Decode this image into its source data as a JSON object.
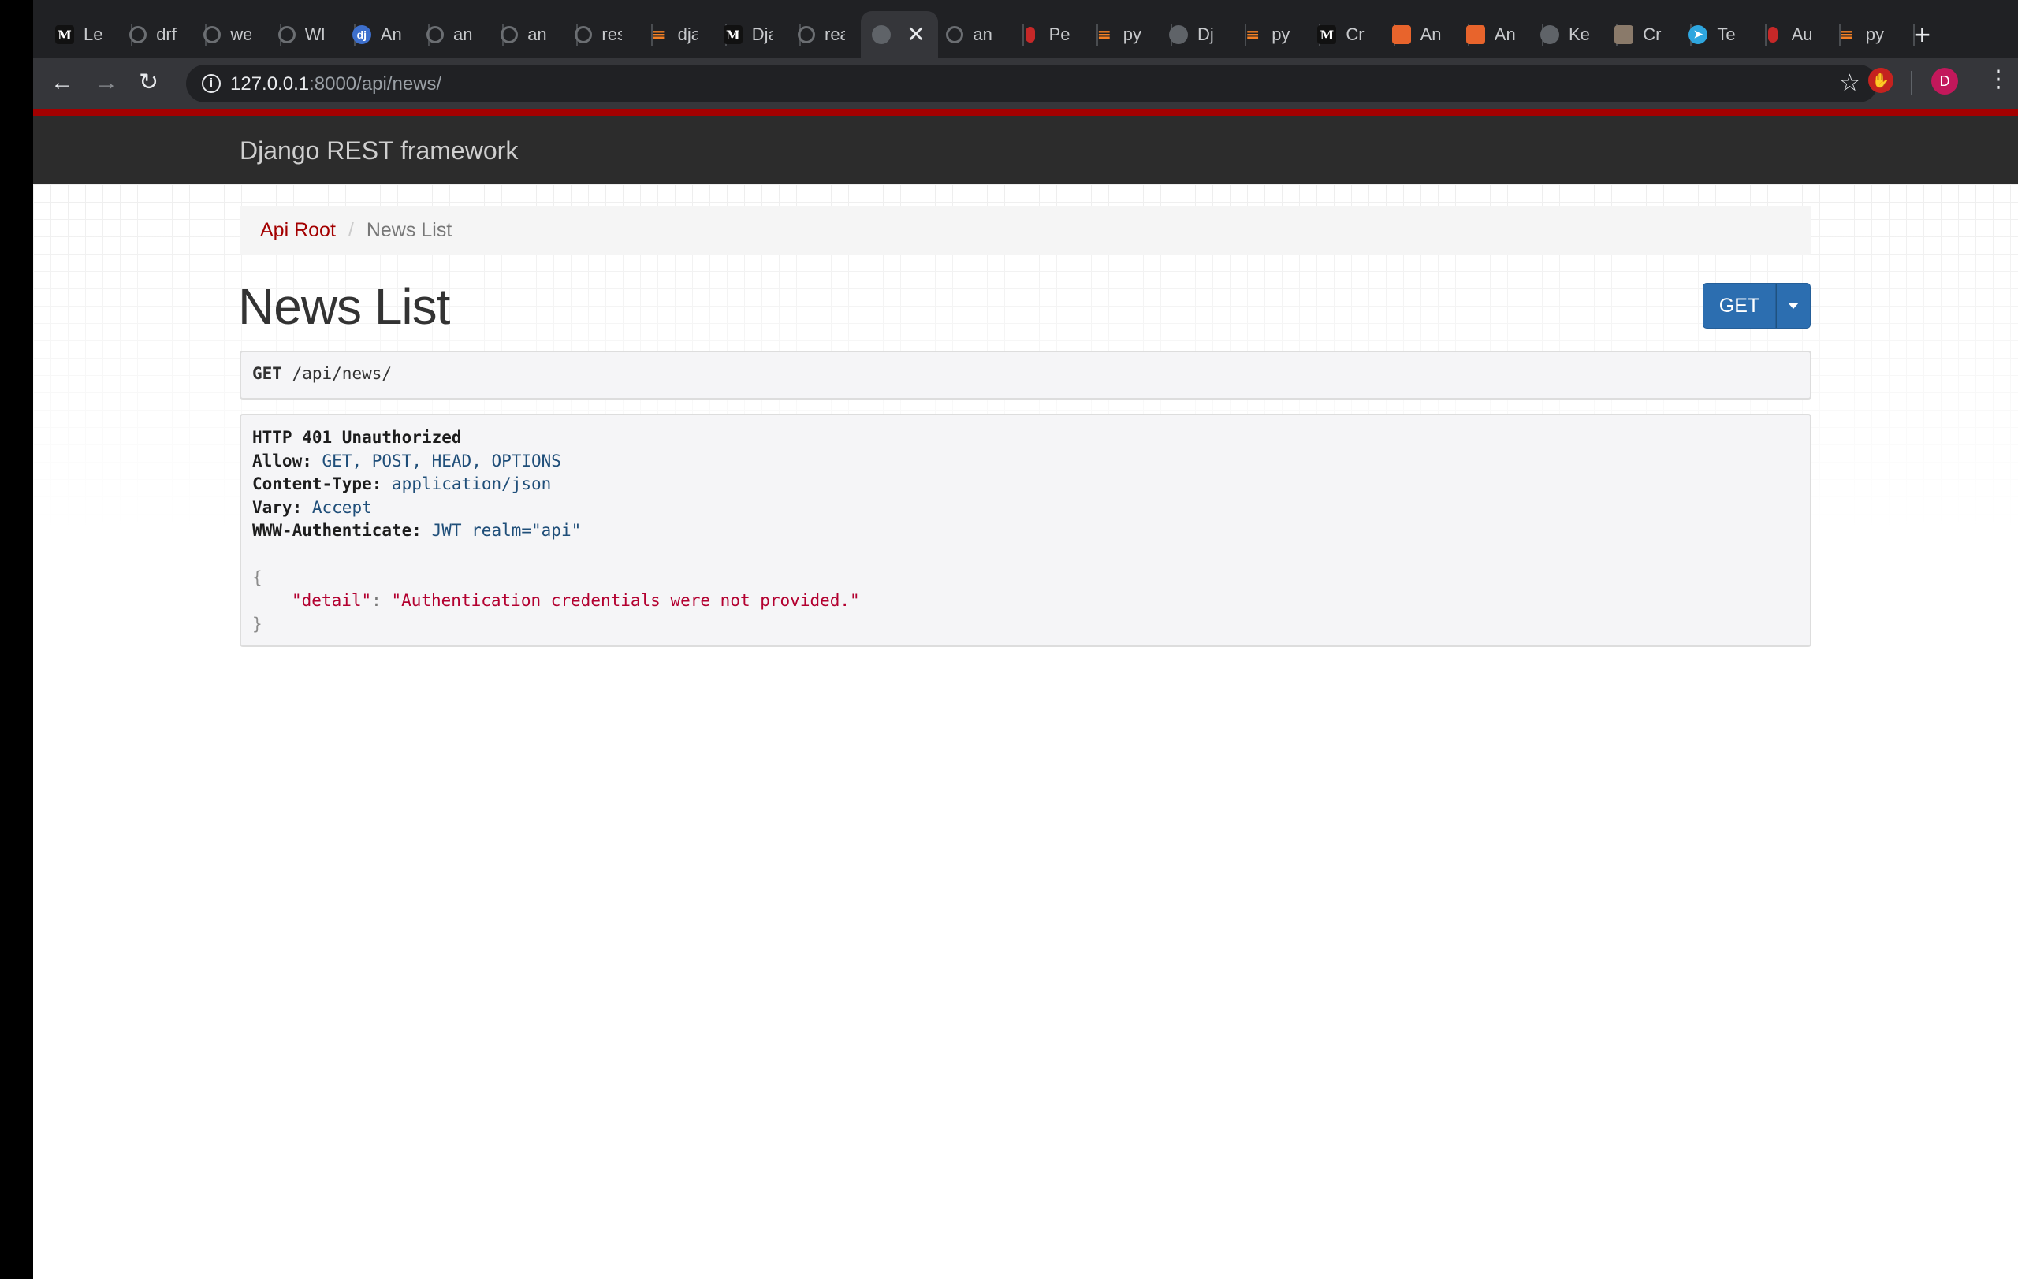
{
  "browser": {
    "tabs": [
      {
        "icon": "medium-icon",
        "title": "Le"
      },
      {
        "icon": "github-icon",
        "title": "drf"
      },
      {
        "icon": "github-icon",
        "title": "we"
      },
      {
        "icon": "github-icon",
        "title": "Wl"
      },
      {
        "icon": "django-icon",
        "title": "An"
      },
      {
        "icon": "github-icon",
        "title": "an"
      },
      {
        "icon": "github-icon",
        "title": "an"
      },
      {
        "icon": "github-icon",
        "title": "res"
      },
      {
        "icon": "stackoverflow-icon",
        "title": "dja"
      },
      {
        "icon": "medium-icon",
        "title": "Dja"
      },
      {
        "icon": "github-icon",
        "title": "rea"
      },
      {
        "icon": "globe-icon",
        "title": "",
        "active": true
      },
      {
        "icon": "github-icon",
        "title": "an"
      },
      {
        "icon": "red-pill-icon",
        "title": "Pe"
      },
      {
        "icon": "stackoverflow-icon",
        "title": "py"
      },
      {
        "icon": "globe-icon",
        "title": "Dj"
      },
      {
        "icon": "stackoverflow-icon",
        "title": "py"
      },
      {
        "icon": "medium-icon",
        "title": "Cr"
      },
      {
        "icon": "orange-app-icon",
        "title": "An"
      },
      {
        "icon": "orange-app-icon",
        "title": "An"
      },
      {
        "icon": "globe-icon",
        "title": "Ke"
      },
      {
        "icon": "photo-icon",
        "title": "Cr"
      },
      {
        "icon": "telegram-icon",
        "title": "Te"
      },
      {
        "icon": "red-pill-icon",
        "title": "Au"
      },
      {
        "icon": "stackoverflow-icon",
        "title": "py"
      }
    ],
    "new_tab_label": "+",
    "url_host": "127.0.0.1",
    "url_path": ":8000/api/news/",
    "avatar_initial": "D",
    "close_glyph": "✕"
  },
  "navbar": {
    "brand": "Django REST framework",
    "accent_color": "#a30000"
  },
  "breadcrumb": {
    "root": "Api Root",
    "separator": "/",
    "current": "News List"
  },
  "page": {
    "title": "News List",
    "get_button": "GET"
  },
  "request": {
    "method": "GET",
    "path": "/api/news/"
  },
  "response": {
    "status": "HTTP 401 Unauthorized",
    "headers": [
      {
        "name": "Allow:",
        "value": "GET, POST, HEAD, OPTIONS"
      },
      {
        "name": "Content-Type:",
        "value": "application/json"
      },
      {
        "name": "Vary:",
        "value": "Accept"
      },
      {
        "name": "WWW-Authenticate:",
        "value": "JWT realm=\"api\""
      }
    ],
    "body_open": "{",
    "body_key": "\"detail\"",
    "body_colon": ": ",
    "body_value": "\"Authentication credentials were not provided.\"",
    "body_close": "}"
  },
  "colors": {
    "get_button": "#2c6eb0",
    "link": "#a30000"
  }
}
